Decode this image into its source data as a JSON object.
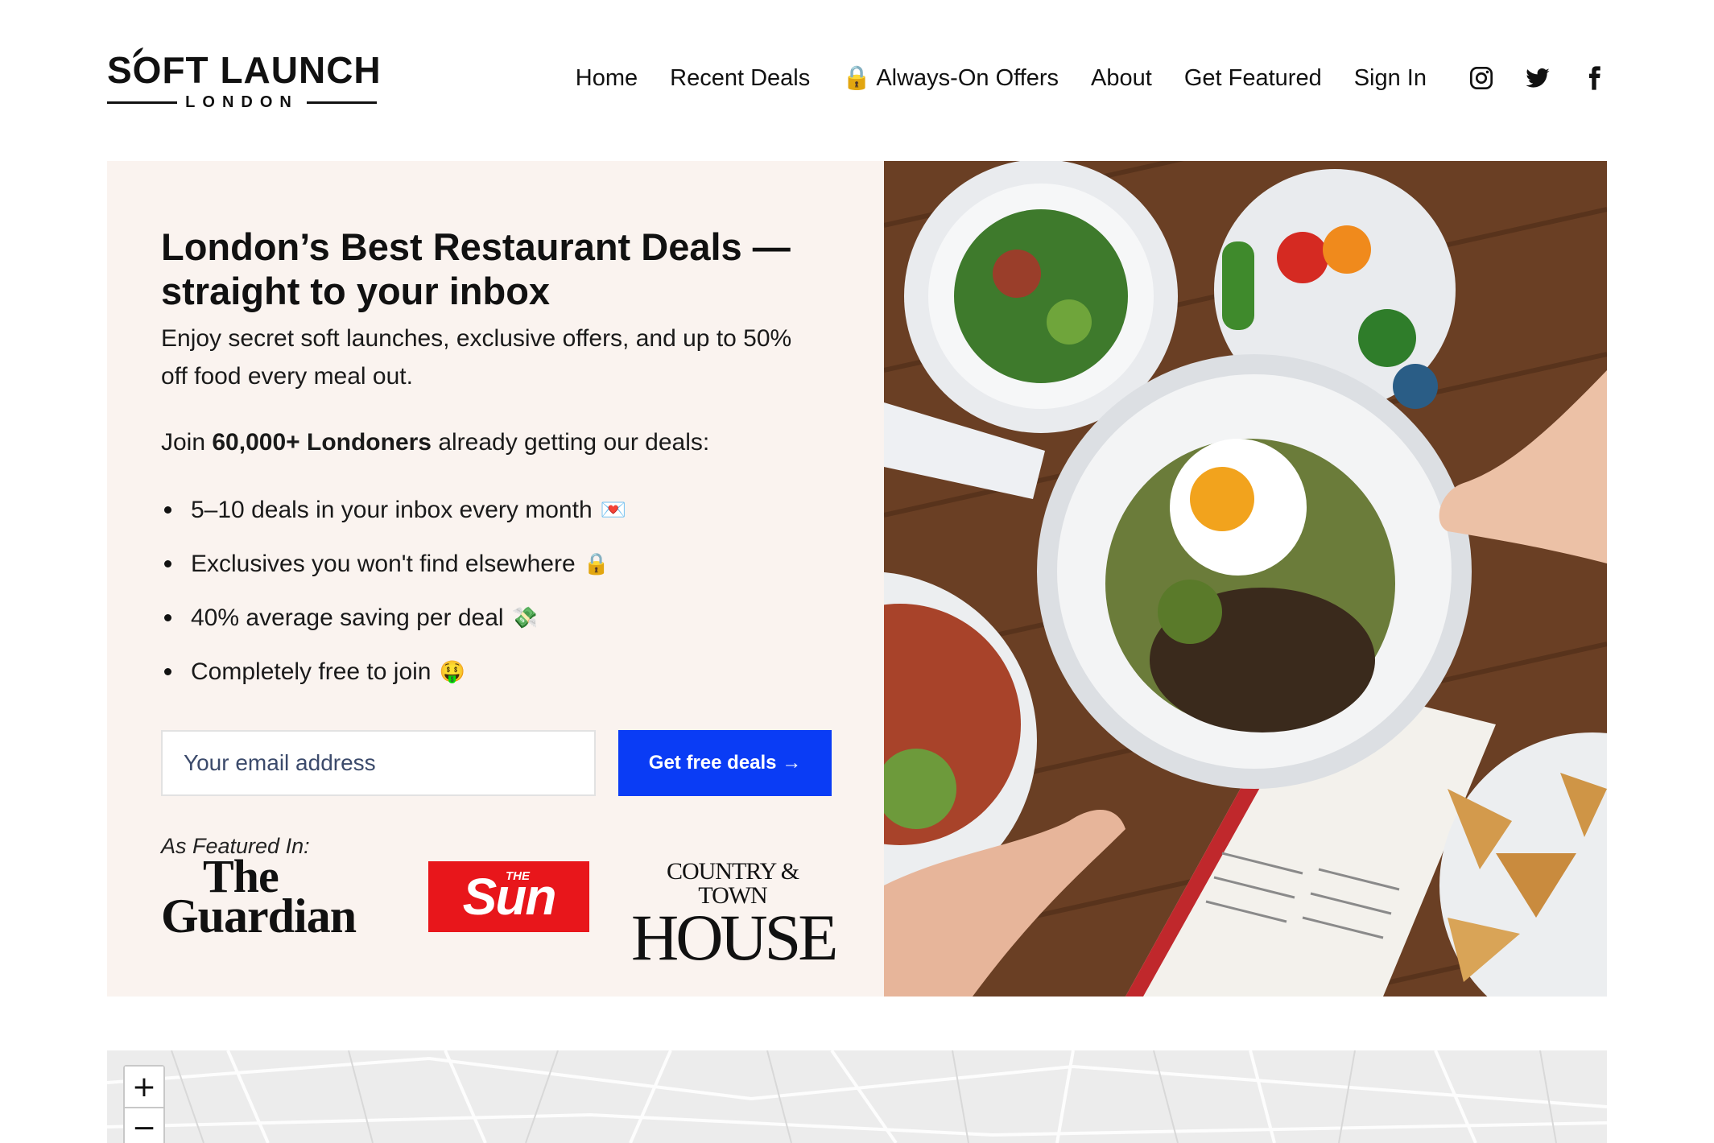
{
  "header": {
    "logo": {
      "main": "SOFT LAUNCH",
      "sub": "LONDON"
    },
    "nav": [
      {
        "label": "Home"
      },
      {
        "label": "Recent Deals"
      },
      {
        "label": "Always-On Offers",
        "icon": "🔒"
      },
      {
        "label": "About"
      },
      {
        "label": "Get Featured"
      },
      {
        "label": "Sign In"
      }
    ],
    "social": [
      "instagram-icon",
      "twitter-icon",
      "facebook-icon"
    ]
  },
  "hero": {
    "headline": "London’s Best Restaurant Deals — straight to your inbox",
    "subtext": "Enjoy secret soft launches, exclusive offers, and up to 50% off food every meal out.",
    "join_prefix": "Join ",
    "join_bold": "60,000+ Londoners",
    "join_suffix": " already getting our deals:",
    "bullets": [
      {
        "text": "5–10 deals in your inbox every month",
        "emoji": "💌"
      },
      {
        "text": "Exclusives you won't find elsewhere",
        "emoji": "🔒"
      },
      {
        "text": "40% average saving per deal",
        "emoji": "💸"
      },
      {
        "text": "Completely free to join",
        "emoji": "🤑"
      }
    ],
    "email_placeholder": "Your email address",
    "cta_label": "Get free deals →",
    "featured_label": "As Featured In:",
    "press": {
      "guardian_the": "The",
      "guardian_name": "Guardian",
      "sun_small": "THE",
      "sun_name": "Sun",
      "cth_top": "COUNTRY & TOWN",
      "cth_bottom": "HOUSE"
    }
  },
  "map": {
    "zoom_in": "+",
    "zoom_out": "−"
  },
  "colors": {
    "cta": "#0a3cf5",
    "hero_bg": "#faf3ef",
    "sun_red": "#e8161b"
  }
}
